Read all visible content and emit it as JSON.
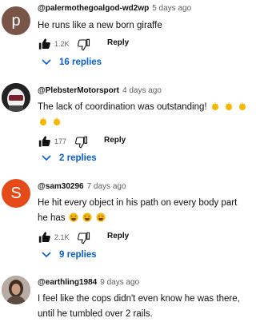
{
  "comments": [
    {
      "avatar_letter": "p",
      "avatar_color": "#795548",
      "handle": "@palermothegoalgod-wd2wp",
      "time": "5 days ago",
      "text": "He runs like a new born giraffe",
      "likes": "1.2K",
      "reply_label": "Reply",
      "replies_label": "16 replies"
    },
    {
      "avatar_letter": "",
      "avatar_color": "#2b2b2b",
      "handle": "@PlebsterMotorsport",
      "time": "4 days ago",
      "text": "The lack of coordination was outstanding!",
      "text_emojis": [
        "clapping-hands",
        "clapping-hands",
        "clapping-hands",
        "clapping-hands",
        "clapping-hands"
      ],
      "likes": "177",
      "reply_label": "Reply",
      "replies_label": "2 replies"
    },
    {
      "avatar_letter": "S",
      "avatar_color": "#e64a19",
      "handle": "@sam30296",
      "time": "7 days ago",
      "text": "He hit every object in his path on every body part he has",
      "text_emojis": [
        "laughing-face",
        "laughing-face",
        "laughing-face"
      ],
      "likes": "2.1K",
      "reply_label": "Reply",
      "replies_label": "9 replies"
    },
    {
      "avatar_letter": "",
      "avatar_color": "#9a8c80",
      "handle": "@earthling1984",
      "time": "9 days ago",
      "text": "I feel like the cops didn't even know he was there, until he tumbled over 2 rails."
    }
  ],
  "colors": {
    "link_blue": "#065fd4",
    "secondary_text": "#606060",
    "emoji_yellow": "#f5b700"
  }
}
